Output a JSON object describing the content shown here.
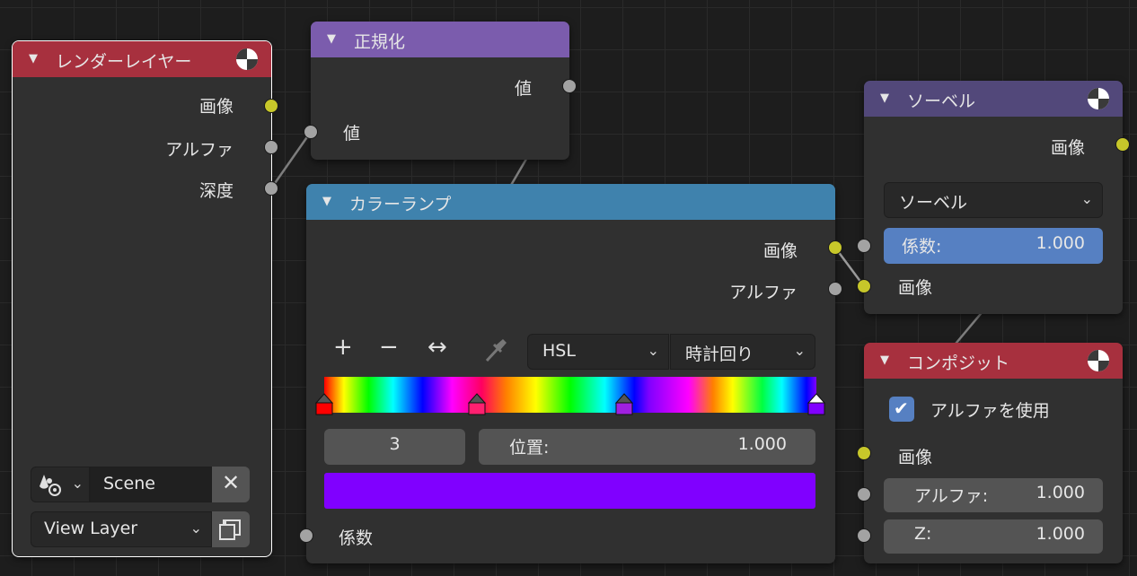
{
  "colors": {
    "header_render_layers": "#a7303e",
    "header_normalize": "#7b5cad",
    "header_colorramp": "#3f82ad",
    "header_sobel": "#52487a",
    "header_composite": "#a7303e",
    "socket_color": "#c7c72a",
    "socket_value": "#a3a3a3",
    "field_selected": "#5680c2",
    "color_swatch": "#8000ff"
  },
  "render_layers": {
    "title": "レンダーレイヤー",
    "outputs": [
      "画像",
      "アルファ",
      "深度"
    ],
    "scene_name": "Scene",
    "view_layer": "View Layer"
  },
  "normalize": {
    "title": "正規化",
    "output": "値",
    "input": "値"
  },
  "colorramp": {
    "title": "カラーランプ",
    "out_image": "画像",
    "out_alpha": "アルファ",
    "toolbar": {
      "add": "+",
      "remove": "−",
      "flip": "↔"
    },
    "color_mode": "HSL",
    "interpolation": "時計回り",
    "active_index": "3",
    "position_label": "位置:",
    "position_value": "1.000",
    "stops": [
      {
        "pos": 0.0,
        "color": "#ff0000"
      },
      {
        "pos": 0.31,
        "color": "#ff2070"
      },
      {
        "pos": 0.61,
        "color": "#a020e0"
      },
      {
        "pos": 1.0,
        "color": "#8000ff"
      }
    ],
    "input_factor": "係数"
  },
  "sobel": {
    "title": "ソーベル",
    "output": "画像",
    "filter_type": "ソーベル",
    "factor_label": "係数:",
    "factor_value": "1.000",
    "input_image": "画像"
  },
  "composite": {
    "title": "コンポジット",
    "use_alpha_label": "アルファを使用",
    "use_alpha_checked": true,
    "input_image": "画像",
    "alpha_label": "アルファ:",
    "alpha_value": "1.000",
    "z_label": "Z:",
    "z_value": "1.000"
  }
}
